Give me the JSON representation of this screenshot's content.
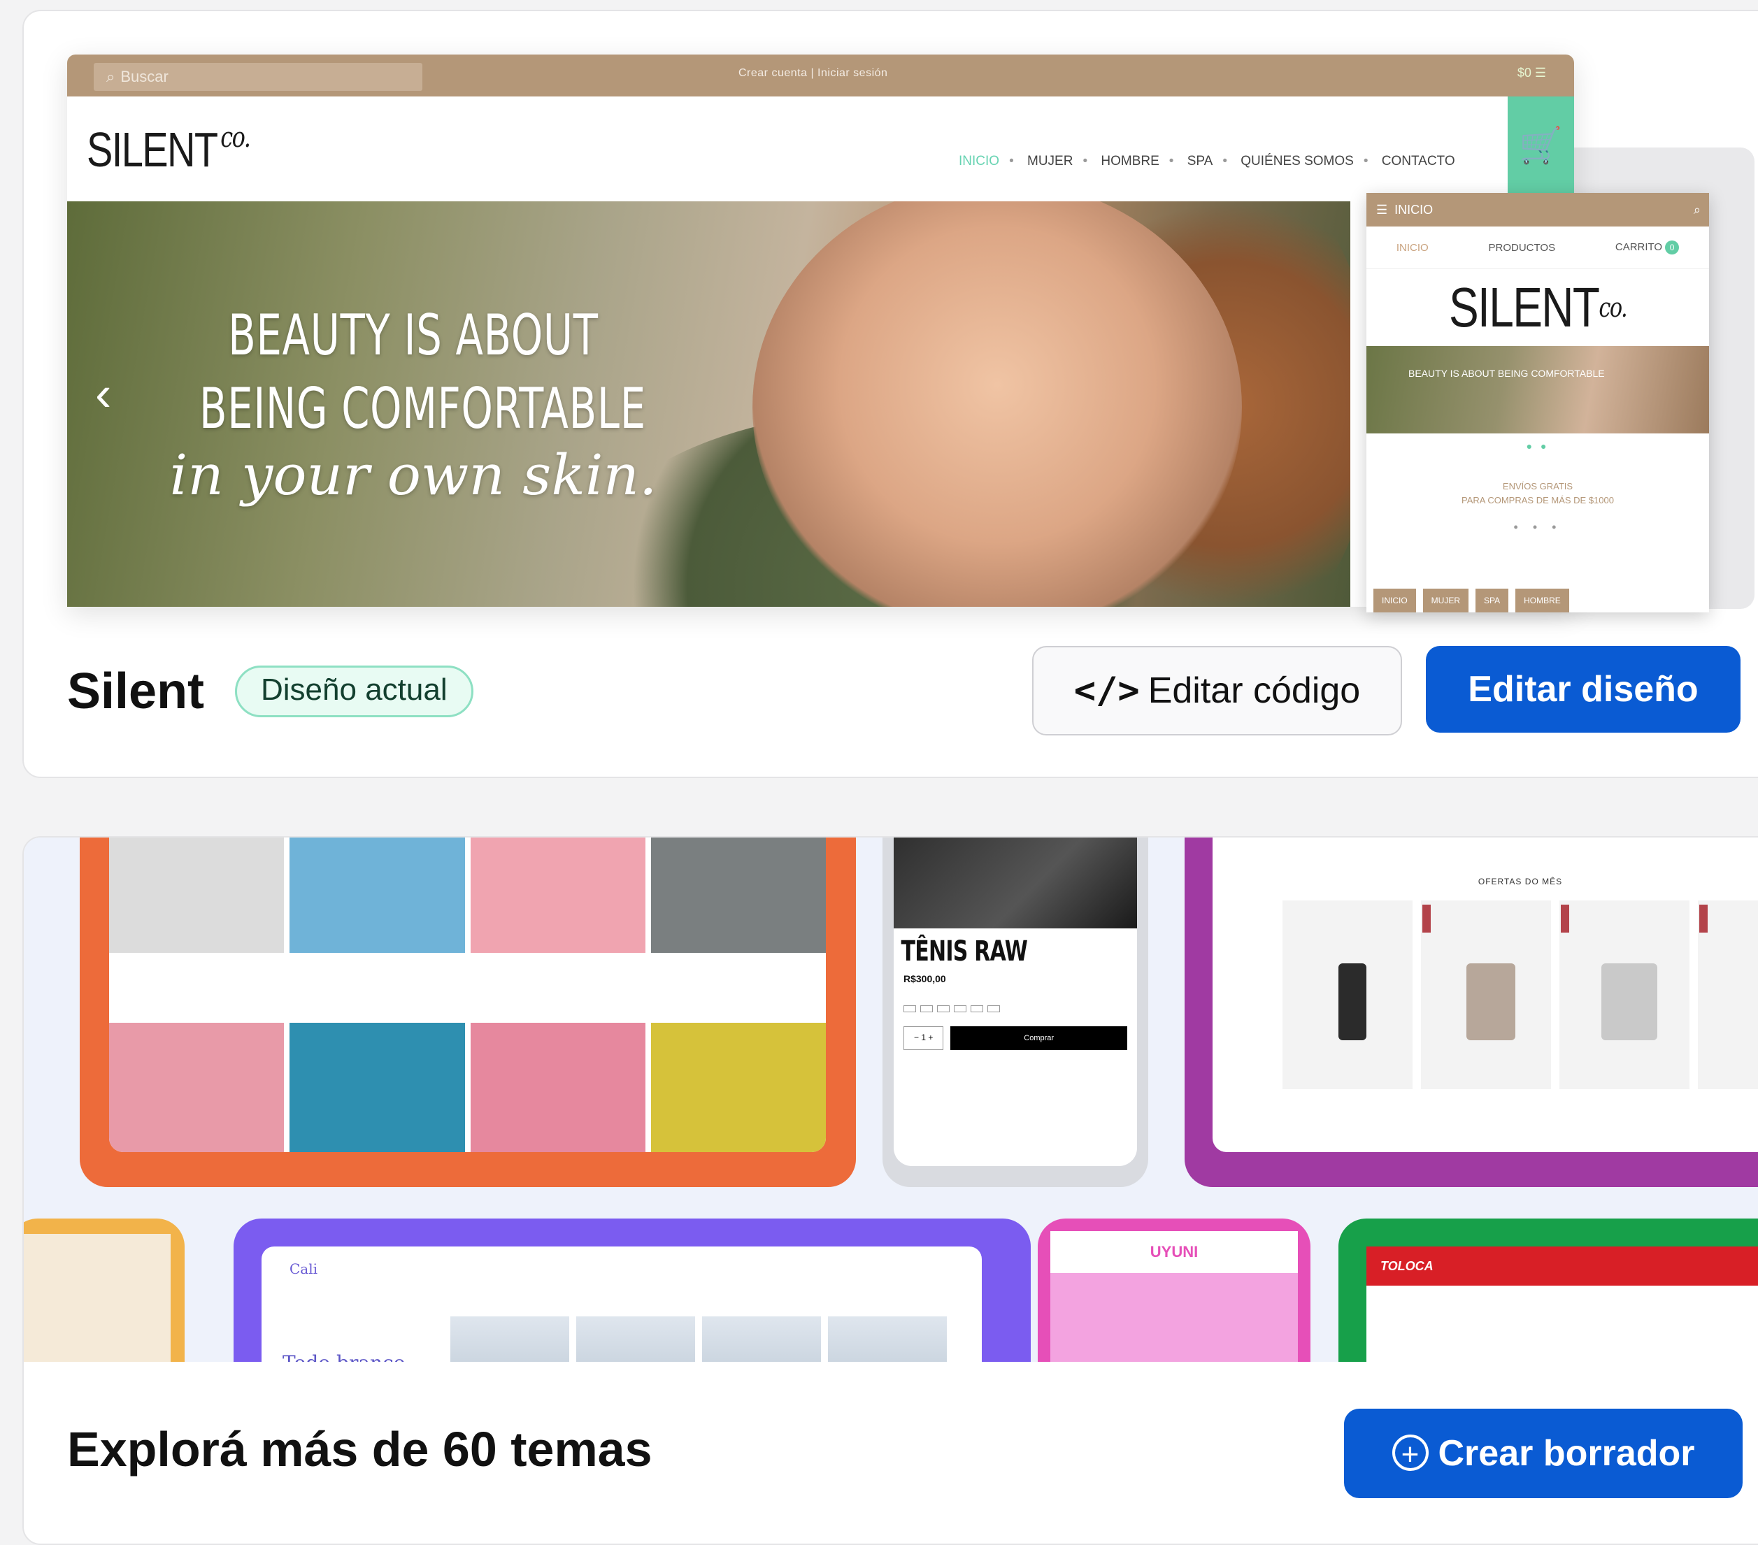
{
  "current_theme": {
    "preview": {
      "topbar": {
        "search_placeholder": "Buscar",
        "center_links": "Crear cuenta  |  Iniciar sesión",
        "right": "$0  ☰"
      },
      "logo_main": "SILENT",
      "logo_suffix": "co.",
      "nav": [
        "INICIO",
        "MUJER",
        "HOMBRE",
        "SPA",
        "QUIÉNES SOMOS",
        "CONTACTO"
      ],
      "hero": {
        "line1": "BEAUTY IS ABOUT",
        "line2": "BEING COMFORTABLE",
        "line3": "in your own skin."
      },
      "mobile": {
        "menu_label": "INICIO",
        "tabs": [
          "INICIO",
          "PRODUCTOS",
          "CARRITO"
        ],
        "cart_count": "0",
        "hero_text": "BEAUTY IS ABOUT BEING COMFORTABLE",
        "shipping_title": "ENVÍOS GRATIS",
        "shipping_sub": "PARA COMPRAS DE MÁS DE $1000",
        "chips": [
          "INICIO",
          "MUJER",
          "SPA",
          "HOMBRE"
        ]
      }
    },
    "name": "Silent",
    "status_badge": "Diseño actual",
    "edit_code_label": "Editar código",
    "edit_design_label": "Editar diseño"
  },
  "explore": {
    "title": "Explorá más de 60 temas",
    "create_draft_label": "Crear borrador",
    "thumbs": {
      "sneaker_title": "TÊNIS RAW",
      "sneaker_price": "R$300,00",
      "sneaker_buy": "Comprar",
      "cosmetics_heading": "OFERTAS DO MÊS",
      "cali_logo": "Cali",
      "cali_heading": "Todo branco",
      "uyuni_logo": "UYUNI",
      "toloca_logo": "TOLOCA"
    }
  },
  "colors": {
    "primary_button": "#0a5bd3",
    "badge_border": "#8ee0c3",
    "silent_brand": "#b49778",
    "silent_accent": "#62cda5"
  },
  "icons": {
    "code": "code-icon",
    "plus": "plus-circle-icon",
    "cart": "cart-icon",
    "arrow": "chevron-left-icon"
  }
}
